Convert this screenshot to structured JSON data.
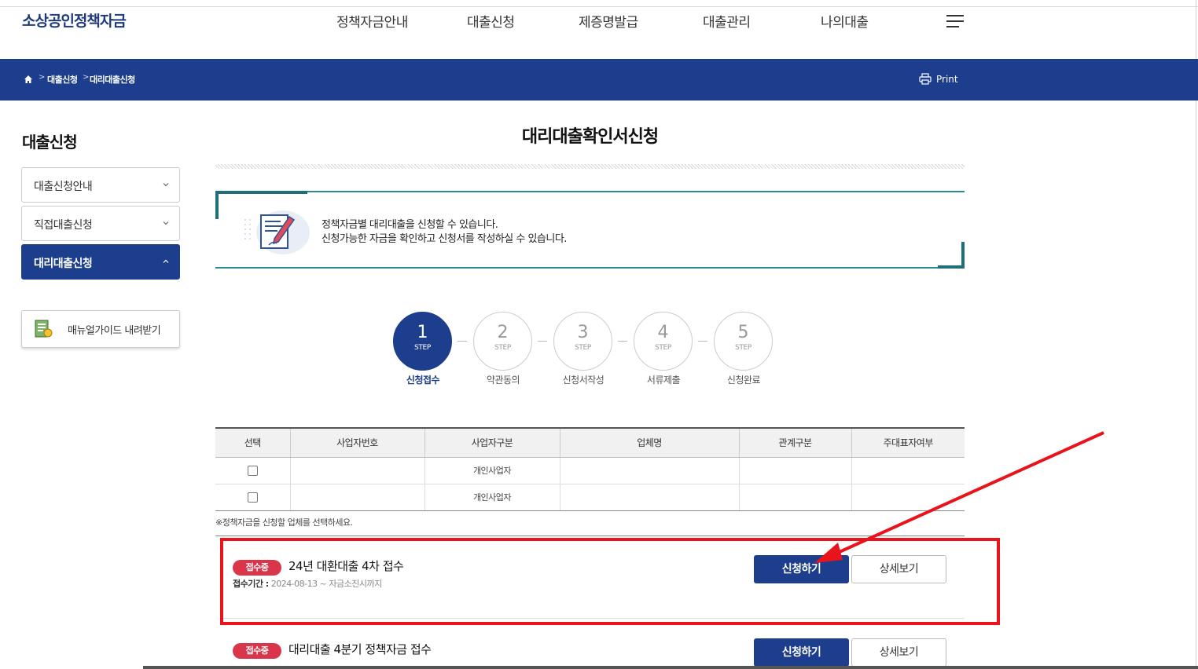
{
  "header": {
    "logo": "소상공인정책자금",
    "nav": [
      "정책자금안내",
      "대출신청",
      "제증명발급",
      "대출관리",
      "나의대출"
    ],
    "menu_icon": "hamburger-icon"
  },
  "breadcrumb": {
    "home_icon": "home-icon",
    "items": [
      "대출신청",
      "대리대출신청"
    ],
    "separator": ">",
    "print": "Print"
  },
  "sidebar": {
    "title": "대출신청",
    "items": [
      {
        "label": "대출신청안내",
        "state": "collapsed"
      },
      {
        "label": "직접대출신청",
        "state": "collapsed"
      },
      {
        "label": "대리대출신청",
        "state": "expanded"
      }
    ],
    "manual_button": "매뉴얼가이드 내려받기"
  },
  "main": {
    "title": "대리대출확인서신청",
    "info_lines": [
      "정책자금별 대리대출을 신청할 수 있습니다.",
      "신청가능한 자금을 확인하고 신청서를 작성하실 수 있습니다."
    ],
    "step_label": "STEP",
    "steps": [
      {
        "num": "1",
        "name": "신청접수",
        "active": true
      },
      {
        "num": "2",
        "name": "약관동의",
        "active": false
      },
      {
        "num": "3",
        "name": "신청서작성",
        "active": false
      },
      {
        "num": "4",
        "name": "서류제출",
        "active": false
      },
      {
        "num": "5",
        "name": "신청완료",
        "active": false
      }
    ],
    "table": {
      "headers": [
        "선택",
        "사업자번호",
        "사업자구분",
        "업체명",
        "관계구분",
        "주대표자여부"
      ],
      "rows": [
        [
          "",
          "",
          "개인사업자",
          "",
          "",
          ""
        ],
        [
          "",
          "",
          "개인사업자",
          "",
          "",
          ""
        ]
      ]
    },
    "note": "※정책자금을 신청할 업체를 선택하세요.",
    "funds": [
      {
        "badge": "접수중",
        "title": "24년 대환대출 4차 접수",
        "period_label": "접수기간 :",
        "period": "2024-08-13 ~ 자금소진시까지",
        "apply": "신청하기",
        "detail": "상세보기"
      },
      {
        "badge": "접수중",
        "title": "대리대출 4분기 정책자금 접수",
        "period_label": "",
        "period": "",
        "apply": "신청하기",
        "detail": "상세보기"
      }
    ]
  },
  "colors": {
    "primary": "#1d3e8c",
    "accent_teal": "#2b8a92",
    "badge_red": "#d9364c",
    "highlight_red": "#e8131b"
  }
}
